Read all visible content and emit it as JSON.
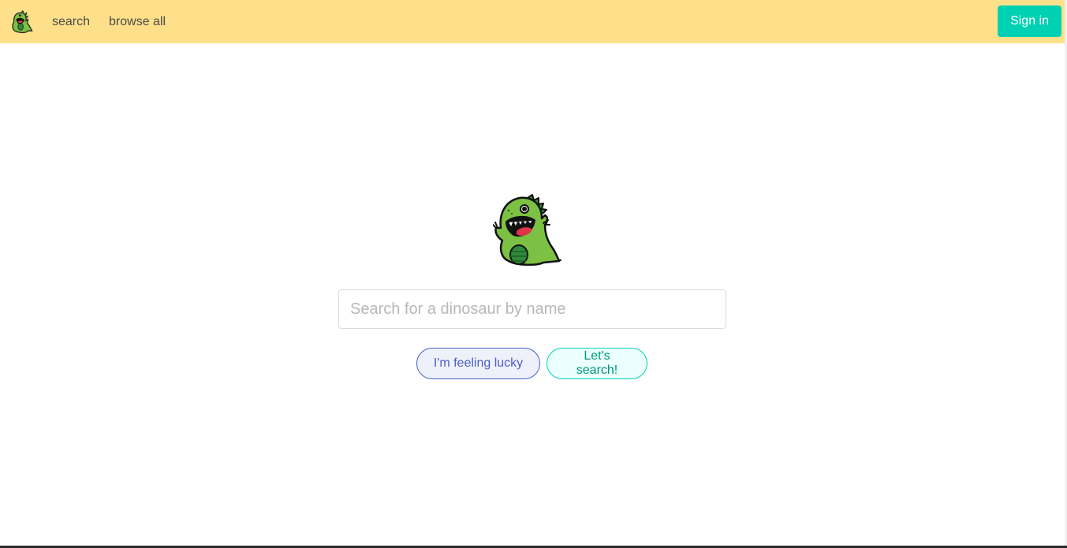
{
  "navbar": {
    "brand_icon": "dinosaur-logo-icon",
    "links": [
      {
        "label": "search"
      },
      {
        "label": "browse all"
      }
    ],
    "signin_label": "Sign in"
  },
  "hero": {
    "logo_icon": "dinosaur-mascot-icon",
    "search": {
      "placeholder": "Search for a dinosaur by name",
      "value": ""
    },
    "buttons": {
      "lucky_label": "I'm feeling lucky",
      "search_label": "Let's search!"
    }
  },
  "colors": {
    "navbar_bg": "#ffe08a",
    "primary": "#00d1b2",
    "link_blue": "#485fc7",
    "dino_green": "#7cc143"
  }
}
